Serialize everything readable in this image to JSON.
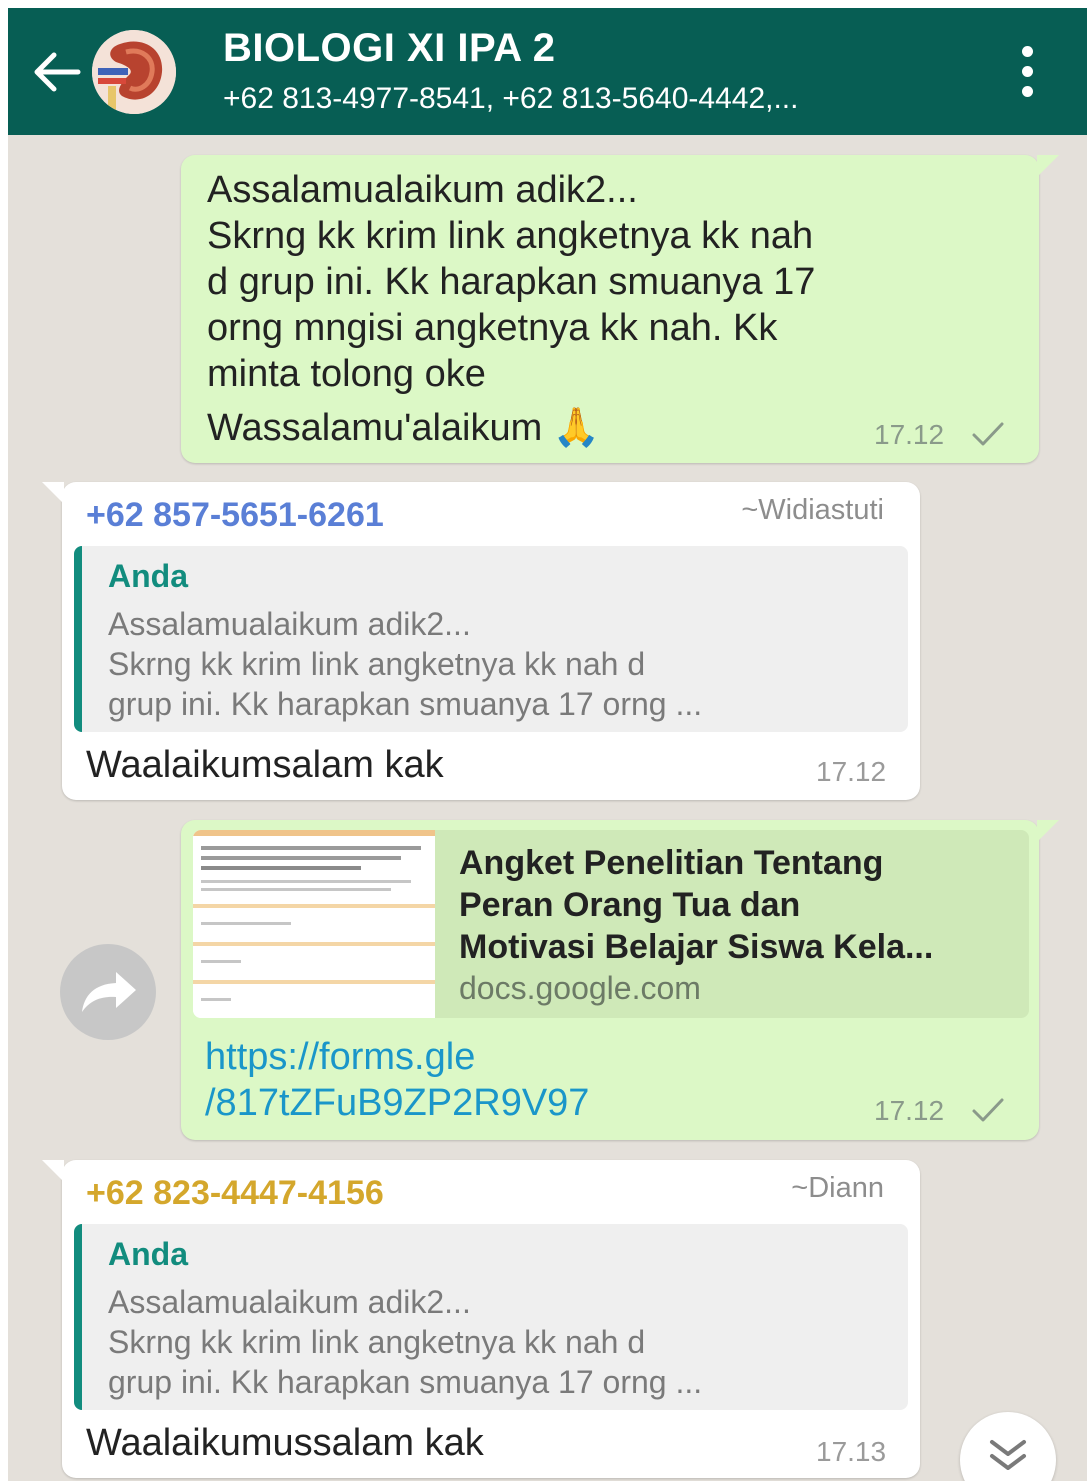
{
  "header": {
    "title": "BIOLOGI XI IPA 2",
    "subtitle": "+62 813-4977-8541, +62 813-5640-4442,..."
  },
  "messages": [
    {
      "lines": [
        "Assalamualaikum adik2...",
        "Skrng kk krim link angketnya kk nah",
        "d grup ini. Kk harapkan smuanya 17",
        "orng mngisi angketnya kk nah. Kk",
        "minta tolong oke",
        "Wassalamu'alaikum 🙏"
      ],
      "time": "17.12"
    },
    {
      "sender_phone": "+62 857-5651-6261",
      "sender_name": "~Widiastuti",
      "sender_color": "#5a7fd6",
      "quote": {
        "author": "Anda",
        "lines": [
          "Assalamualaikum adik2...",
          "Skrng kk krim link angketnya kk nah d",
          "grup ini. Kk harapkan smuanya 17 orng ..."
        ]
      },
      "text": "Waalaikumsalam kak",
      "time": "17.12"
    },
    {
      "preview": {
        "title_lines": [
          "Angket Penelitian Tentang",
          "Peran Orang Tua dan",
          "Motivasi Belajar Siswa Kela..."
        ],
        "domain": "docs.google.com"
      },
      "link_lines": [
        "https://forms.gle",
        "/817tZFuB9ZP2R9V97"
      ],
      "time": "17.12"
    },
    {
      "sender_phone": "+62 823-4447-4156",
      "sender_name": "~Diann",
      "sender_color": "#d4a72c",
      "quote": {
        "author": "Anda",
        "lines": [
          "Assalamualaikum adik2...",
          "Skrng kk krim link angketnya kk nah d",
          "grup ini. Kk harapkan smuanya 17 orng ..."
        ]
      },
      "text": "Waalaikumussalam kak",
      "time": "17.13"
    }
  ],
  "icons": {
    "back": "arrow-left-icon",
    "menu": "more-vertical-icon",
    "tick": "check-icon",
    "forward": "share-icon",
    "scroll": "chevron-double-down-icon"
  }
}
